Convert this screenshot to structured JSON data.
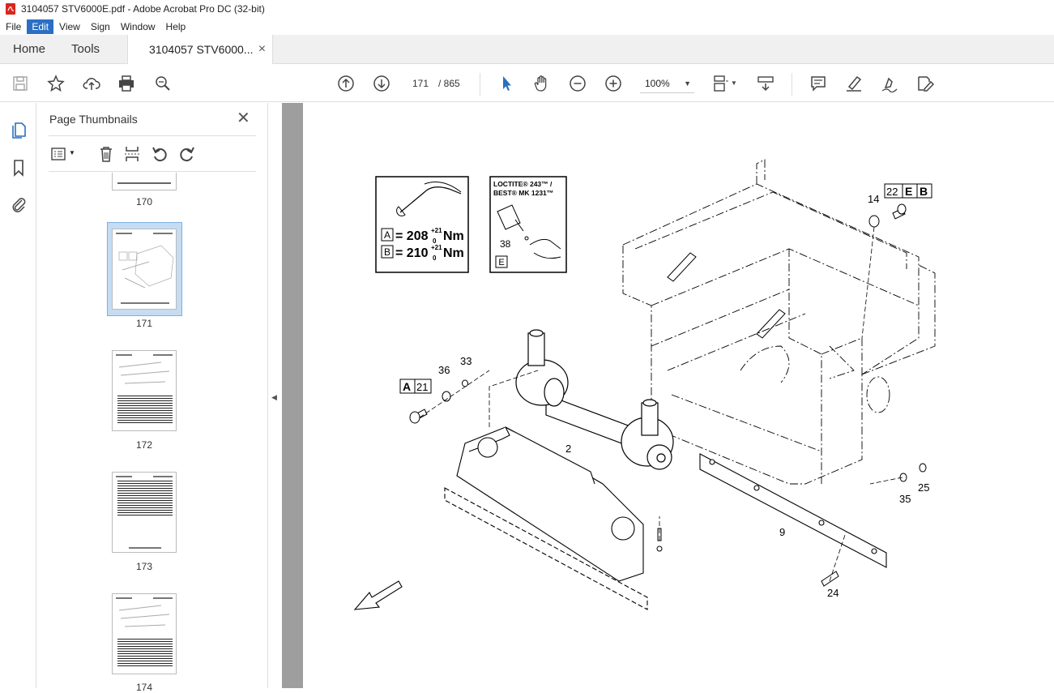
{
  "window": {
    "title": "3104057 STV6000E.pdf - Adobe Acrobat Pro DC (32-bit)"
  },
  "menu": {
    "items": [
      "File",
      "Edit",
      "View",
      "Sign",
      "Window",
      "Help"
    ],
    "active": "Edit"
  },
  "tabs": {
    "home": "Home",
    "tools": "Tools",
    "document": "3104057 STV6000...",
    "close": "×"
  },
  "toolbar": {
    "current_page": "171",
    "total_pages": "/ 865",
    "zoom": "100%"
  },
  "thumbnails_panel": {
    "title": "Page Thumbnails",
    "pages": [
      "170",
      "171",
      "172",
      "173",
      "174"
    ],
    "selected_page": "171"
  },
  "drawing": {
    "torque_box": {
      "labels": [
        "A",
        "B"
      ],
      "a_value": "= 208",
      "b_value": "= 210",
      "sup": "+21",
      "sub": "0",
      "unit": "Nm"
    },
    "loctite_box": {
      "line1": "LOCTITE® 243™ /",
      "line2": "BEST® MK 1231™",
      "part": "38",
      "label": "E"
    },
    "callouts": {
      "c14": "14",
      "c22": "22",
      "cE": "E",
      "cB": "B",
      "cA": "A",
      "c21": "21",
      "c36": "36",
      "c33": "33",
      "c2": "2",
      "c9": "9",
      "c25": "25",
      "c35": "35",
      "c24": "24"
    }
  }
}
